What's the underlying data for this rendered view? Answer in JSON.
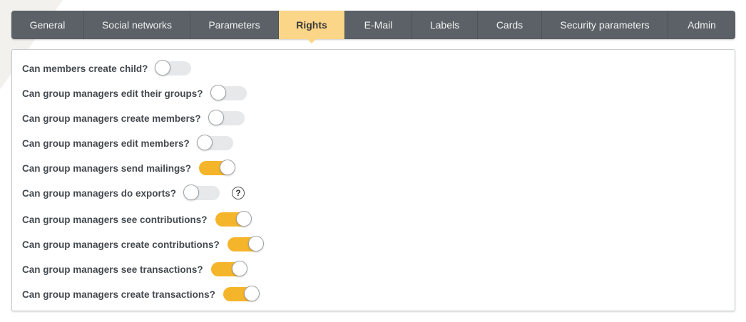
{
  "tabs": [
    {
      "label": "General"
    },
    {
      "label": "Social networks"
    },
    {
      "label": "Parameters"
    },
    {
      "label": "Rights",
      "active": true
    },
    {
      "label": "E-Mail"
    },
    {
      "label": "Labels"
    },
    {
      "label": "Cards"
    },
    {
      "label": "Security parameters"
    },
    {
      "label": "Admin"
    }
  ],
  "rights": [
    {
      "label": "Can members create child?",
      "enabled": false
    },
    {
      "label": "Can group managers edit their groups?",
      "enabled": false
    },
    {
      "label": "Can group managers create members?",
      "enabled": false
    },
    {
      "label": "Can group managers edit members?",
      "enabled": false
    },
    {
      "label": "Can group managers send mailings?",
      "enabled": true
    },
    {
      "label": "Can group managers do exports?",
      "enabled": false,
      "help": "?"
    },
    {
      "label": "Can group managers see contributions?",
      "enabled": true
    },
    {
      "label": "Can group managers create contributions?",
      "enabled": true
    },
    {
      "label": "Can group managers see transactions?",
      "enabled": true
    },
    {
      "label": "Can group managers create transactions?",
      "enabled": true
    }
  ],
  "colors": {
    "tab_bar": "#5b6166",
    "tab_active": "#fcd688",
    "toggle_on": "#f5b52a",
    "toggle_off": "#e6e8ea"
  }
}
